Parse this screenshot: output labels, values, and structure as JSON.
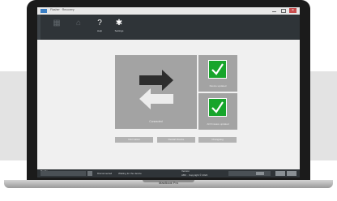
{
  "window": {
    "title": "Flasher · Recovery"
  },
  "toolbar": {
    "buttons": [
      {
        "name": "tool-1",
        "icon": "grid-icon",
        "label": ""
      },
      {
        "name": "tool-2",
        "icon": "home-icon",
        "label": ""
      },
      {
        "name": "help",
        "icon": "question-icon",
        "label": "Help"
      },
      {
        "name": "settings",
        "icon": "gear-icon",
        "label": "Settings"
      }
    ]
  },
  "tiles": {
    "main": {
      "label": "Connected",
      "icon": "arrows-swap-icon"
    },
    "top_right": {
      "label": "Device updated",
      "icon": "check-icon"
    },
    "bottom_right": {
      "label": "All firmware updated",
      "icon": "check-icon"
    }
  },
  "actions": [
    "Information",
    "Restart Device",
    "Changelog"
  ],
  "status": {
    "left": "Ready",
    "middle_a": "Disconnected",
    "middle_b": "Waiting for the device",
    "right_top": "Version",
    "right_bottom": "ABC · Copyright © 2024"
  },
  "device": {
    "brand_label": "MacBook Pro"
  },
  "colors": {
    "toolbar": "#2f3438",
    "tile": "#a3a3a3",
    "check_green": "#17a52b",
    "arrow_dark": "#2d2d2d",
    "arrow_light": "#ececec"
  }
}
